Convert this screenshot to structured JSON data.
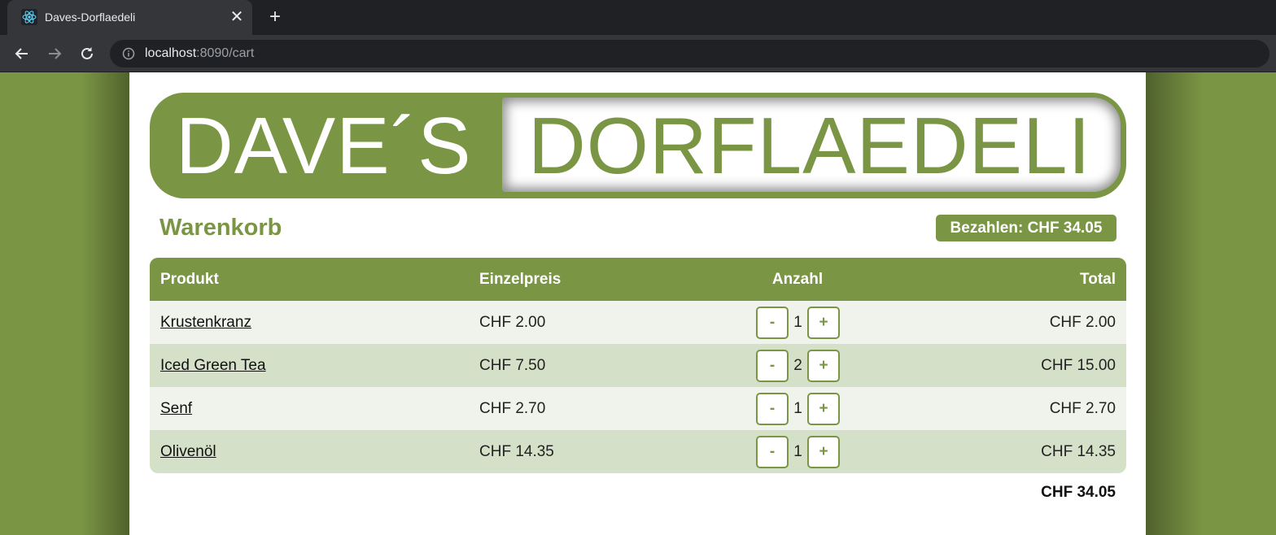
{
  "browser": {
    "tab_title": "Daves-Dorflaedeli",
    "close_glyph": "✕",
    "new_tab_glyph": "+",
    "url_host": "localhost",
    "url_path": ":8090/cart"
  },
  "banner": {
    "left_text": "DAVE´S",
    "right_text": "DORFLAEDELI"
  },
  "cart": {
    "title": "Warenkorb",
    "pay_button": "Bezahlen: CHF 34.05",
    "headers": {
      "product": "Produkt",
      "unit_price": "Einzelpreis",
      "quantity": "Anzahl",
      "total": "Total"
    },
    "minus_label": "-",
    "plus_label": "+",
    "rows": [
      {
        "product": "Krustenkranz",
        "unit_price": "CHF 2.00",
        "quantity": "1",
        "total": "CHF 2.00"
      },
      {
        "product": "Iced Green Tea",
        "unit_price": "CHF 7.50",
        "quantity": "2",
        "total": "CHF 15.00"
      },
      {
        "product": "Senf",
        "unit_price": "CHF 2.70",
        "quantity": "1",
        "total": "CHF 2.70"
      },
      {
        "product": "Olivenöl",
        "unit_price": "CHF 14.35",
        "quantity": "1",
        "total": "CHF 14.35"
      }
    ],
    "grand_total": "CHF 34.05"
  },
  "colors": {
    "brand_green": "#7a9544",
    "row_light": "#f0f3ec",
    "row_dark": "#d5e0c8"
  },
  "icons": [
    "react-favicon-icon",
    "close-icon",
    "plus-icon",
    "back-arrow-icon",
    "forward-arrow-icon",
    "reload-icon",
    "info-icon"
  ]
}
